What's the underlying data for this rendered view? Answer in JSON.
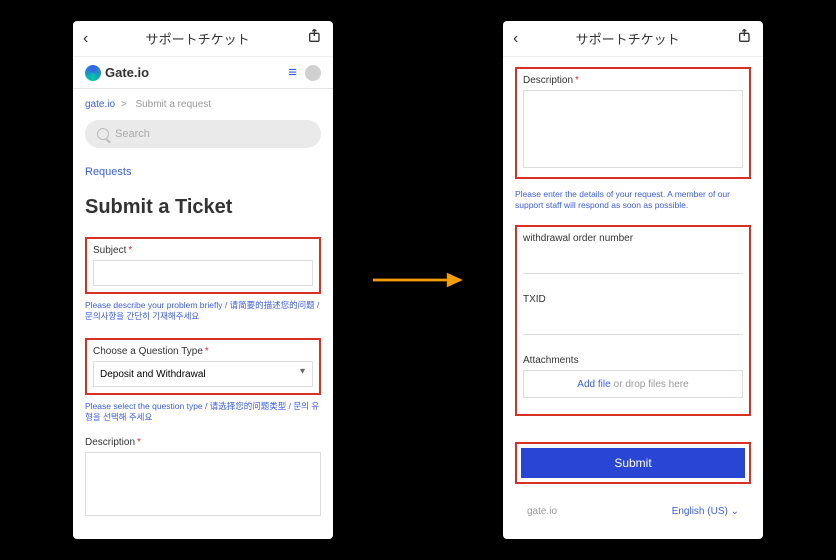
{
  "header": {
    "title": "サポートチケット",
    "back_icon": "‹",
    "share_icon": "⎋"
  },
  "brand": {
    "name": "Gate.io",
    "hamburger": "≡"
  },
  "breadcrumb": {
    "root": "gate.io",
    "sep": ">",
    "current": "Submit a request"
  },
  "search": {
    "placeholder": "Search"
  },
  "links": {
    "requests": "Requests"
  },
  "page_title": "Submit a Ticket",
  "left": {
    "subject": {
      "label": "Subject",
      "hint": "Please describe your problem briefly / 请简要的描述您的问题 / 문의사항을 간단히 기재해주세요"
    },
    "question_type": {
      "label": "Choose a Question Type",
      "value": "Deposit and Withdrawal",
      "hint": "Please select the question type / 请选择您的问题类型 / 문의 유형을 선택해 주세요"
    },
    "description": {
      "label": "Description"
    }
  },
  "right": {
    "description": {
      "label": "Description",
      "hint": "Please enter the details of your request. A member of our support staff will respond as soon as possible."
    },
    "withdrawal_order": {
      "label": "withdrawal order number"
    },
    "txid": {
      "label": "TXID"
    },
    "attachments": {
      "label": "Attachments",
      "add_link": "Add file",
      "drop_text": " or drop files here"
    },
    "submit": "Submit"
  },
  "footer": {
    "brand": "gate.io",
    "lang": "English (US)",
    "chevron": "⌄"
  }
}
